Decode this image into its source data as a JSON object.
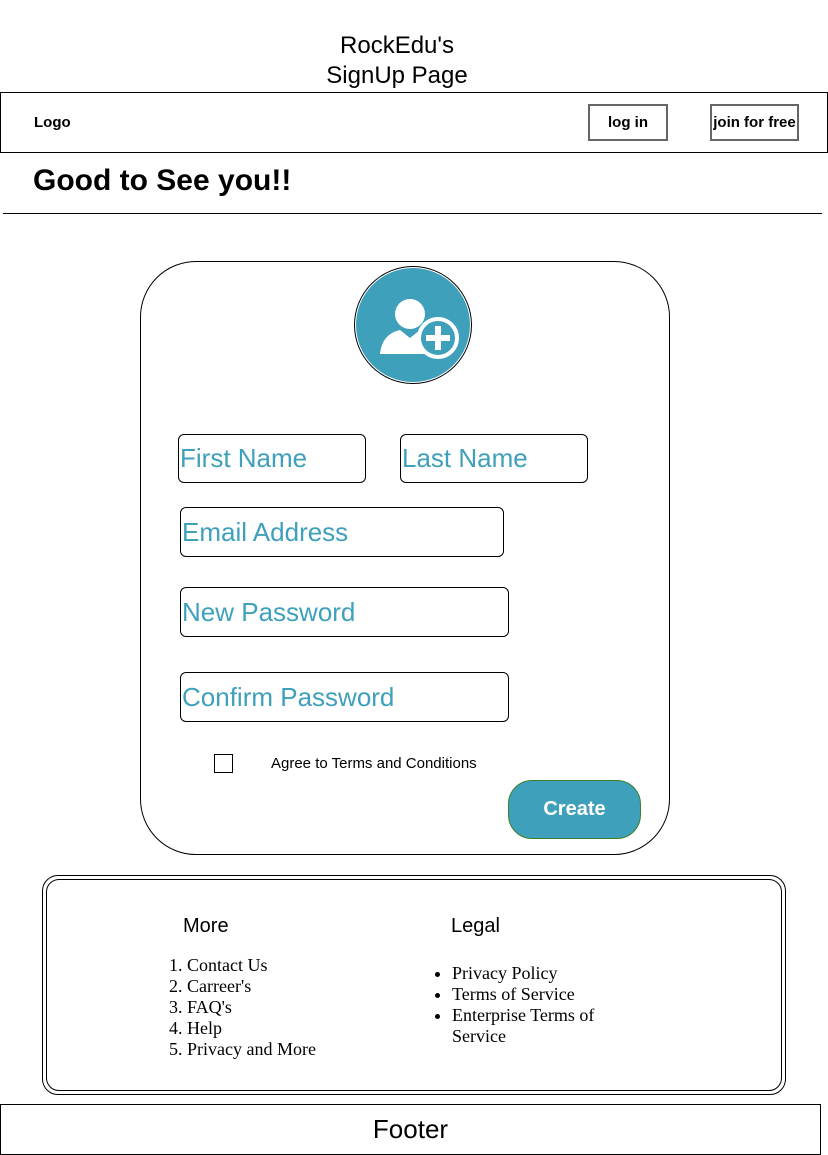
{
  "page": {
    "title_line1": "RockEdu's",
    "title_line2": "SignUp Page"
  },
  "navbar": {
    "logo": "Logo",
    "login_label": "log in",
    "join_label": "join for free"
  },
  "greeting": "Good to See you!!",
  "form": {
    "avatar_icon": "add-user-icon",
    "first_name_placeholder": "First Name",
    "last_name_placeholder": "Last Name",
    "email_placeholder": "Email Address",
    "new_password_placeholder": "New Password",
    "confirm_password_placeholder": "Confirm Password",
    "terms_label": "Agree to Terms and Conditions",
    "terms_checked": false,
    "create_label": "Create"
  },
  "footer": {
    "more_title": "More",
    "more_items": [
      "Contact Us",
      "Carreer's",
      "FAQ's",
      "Help",
      "Privacy and More"
    ],
    "legal_title": "Legal",
    "legal_items": [
      "Privacy Policy",
      "Terms of Service",
      "Enterprise Terms of Service"
    ],
    "bar_label": "Footer"
  },
  "colors": {
    "accent": "#3fa0bb",
    "create_border": "#3d7f2a"
  }
}
